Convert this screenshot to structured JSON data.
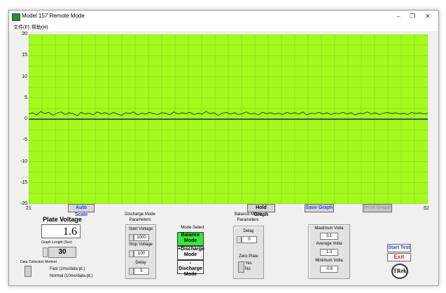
{
  "window": {
    "title": "Model 157 Remote Mode"
  },
  "menu": [
    "文件(F)",
    "帮助(H)"
  ],
  "colors": {
    "plot_bg": "#a3fa1d",
    "trace": "#1a3a1a",
    "zero_line": "#1a237e",
    "accent_blue": "#1d3df5",
    "exit_red": "#e31b1b"
  },
  "chart_data": {
    "type": "line",
    "x_start": "21",
    "x_end": "52",
    "y_ticks": [
      "20",
      "15",
      "10",
      "5",
      "0",
      "-5",
      "-10",
      "-15",
      "-20"
    ],
    "ylim": [
      -20,
      20
    ],
    "xlim": [
      21,
      52
    ],
    "grid": true,
    "series": [
      {
        "values": [
          1.2,
          1.5,
          1.0,
          1.8,
          1.3,
          1.6,
          0.9,
          1.4,
          1.7,
          1.1,
          1.5,
          1.3,
          0.8,
          1.6,
          1.2,
          1.4,
          1.0,
          1.7,
          1.3,
          1.5,
          1.1,
          1.6,
          1.2,
          0.9,
          1.5,
          1.3,
          1.7,
          1.0,
          1.4,
          1.2,
          1.6,
          1.3,
          1.1,
          1.5,
          1.4,
          1.0,
          1.7,
          1.2,
          1.5,
          1.3,
          1.6,
          1.1,
          1.4,
          1.2,
          1.8,
          1.3,
          1.5,
          0.9,
          1.4,
          1.6,
          1.2,
          1.5,
          1.1,
          1.3,
          1.7,
          1.2,
          1.4,
          1.0,
          1.6,
          1.3,
          1.5,
          1.2,
          1.4,
          1.1,
          1.6,
          1.3,
          1.5,
          1.2,
          1.7,
          1.0,
          1.4,
          1.3,
          1.6,
          1.2,
          1.5,
          1.1,
          1.4,
          1.3,
          1.6,
          1.2,
          1.5,
          1.0,
          1.4,
          1.3,
          1.7,
          1.2,
          1.5,
          1.1,
          1.4,
          1.6,
          1.3,
          1.5,
          1.2,
          1.4,
          1.1,
          1.6,
          1.3,
          1.5,
          1.2,
          1.4
        ]
      }
    ]
  },
  "graph_buttons": {
    "auto_scale": "Auto Scale",
    "hold_graph": "Hold Graph",
    "save_graph": "Save Graph",
    "print_graph": "Print Graph"
  },
  "plate_voltage": {
    "label": "Plate Voltage",
    "value": "1.6"
  },
  "graph_length": {
    "label": "Graph Length (Sec)",
    "value": "30"
  },
  "data_collection": {
    "label": "Data Collection Method",
    "fast": "Fast (1ms/data pt.)",
    "normal": "Normal (10ms/data pt.)"
  },
  "discharge": {
    "title": "Discharge Mode\nParameters",
    "start_label": "Start Voltage",
    "start_value": "1000",
    "stop_label": "Stop Voltage",
    "stop_value": "100",
    "delay_label": "Delay",
    "delay_value": "5"
  },
  "mode_select": {
    "label": "Mode Select",
    "balance": "Balance\nMode",
    "plus_discharge": "+Discharge\nMode",
    "minus_discharge": "-Discharge\nMode"
  },
  "balance": {
    "title": "Balance Mode\nParameters",
    "delay_label": "Delay",
    "delay_value": "0",
    "zero_plate_label": "Zero Plate",
    "yes": "Yes",
    "no": "No"
  },
  "stats": {
    "max_label": "Maximum Volta",
    "max_value": "3.1",
    "avg_label": "Average Volta",
    "avg_value": "1.3",
    "min_label": "Minimum Volta",
    "min_value": "-0.6"
  },
  "controls": {
    "start_test": "Start Test",
    "exit": "Exit",
    "logo": "TRek"
  }
}
